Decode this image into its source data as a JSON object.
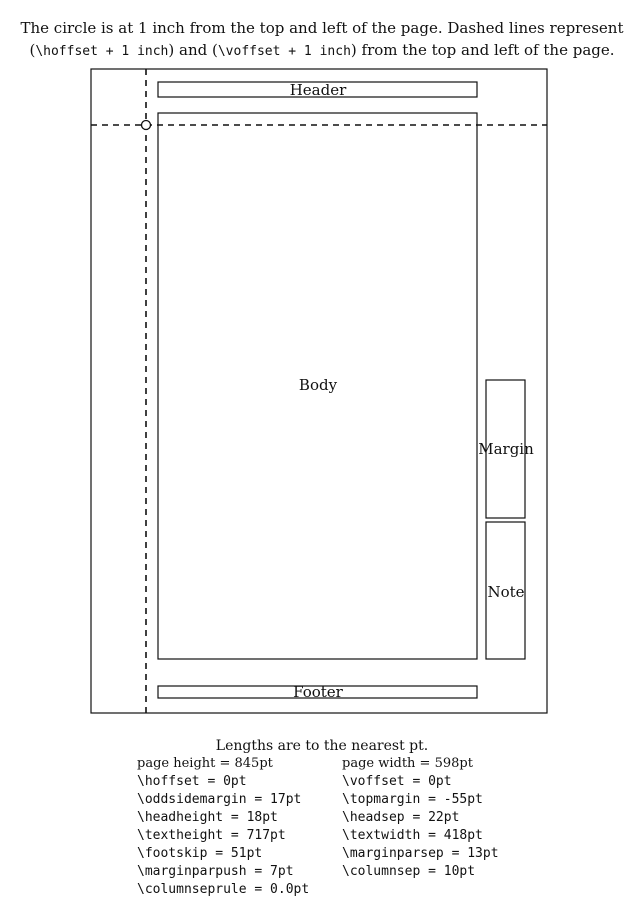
{
  "caption": {
    "line1": "The circle is at 1 inch from the top and left of the page. Dashed lines represent",
    "line2_pre": "(",
    "line2_code1": "\\hoffset + 1 inch",
    "line2_mid": ") and (",
    "line2_code2": "\\voffset + 1 inch",
    "line2_post": ") from the top and left of the page."
  },
  "diagram": {
    "header_label": "Header",
    "body_label": "Body",
    "margin_label": "Margin",
    "note_label": "Note",
    "footer_label": "Footer"
  },
  "lengths": {
    "title": "Lengths are to the nearest pt.",
    "rows": [
      [
        "page height = 845pt",
        "page width = 598pt"
      ],
      [
        "\\hoffset = 0pt",
        "\\voffset = 0pt"
      ],
      [
        "\\oddsidemargin = 17pt",
        "\\topmargin = -55pt"
      ],
      [
        "\\headheight = 18pt",
        "\\headsep = 22pt"
      ],
      [
        "\\textheight = 717pt",
        "\\textwidth = 418pt"
      ],
      [
        "\\footskip = 51pt",
        "\\marginparsep = 13pt"
      ],
      [
        "\\marginparpush = 7pt",
        "\\columnsep = 10pt"
      ],
      [
        "\\columnseprule = 0.0pt",
        ""
      ]
    ]
  }
}
